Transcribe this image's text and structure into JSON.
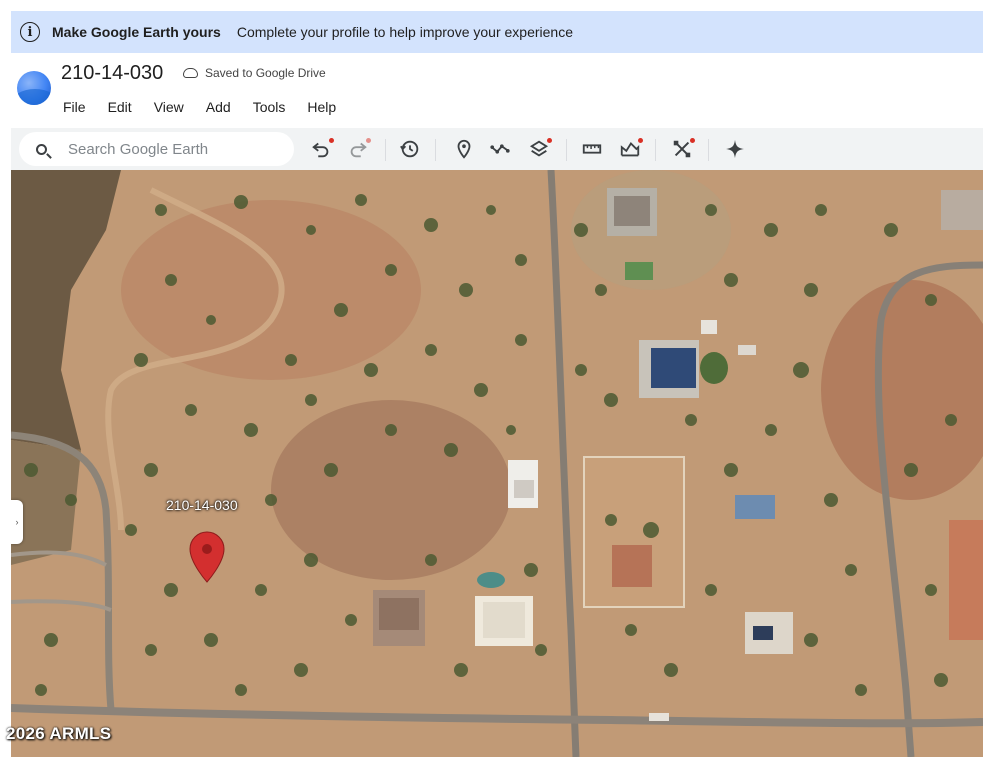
{
  "banner": {
    "title": "Make Google Earth yours",
    "message": "Complete your profile to help improve your experience",
    "icon": "info-icon"
  },
  "header": {
    "project_title": "210-14-030",
    "saved_status": "Saved to Google Drive",
    "menu": [
      "File",
      "Edit",
      "View",
      "Add",
      "Tools",
      "Help"
    ]
  },
  "toolbar": {
    "search_placeholder": "Search Google Earth",
    "tools": [
      "undo-icon",
      "redo-icon",
      "history-icon",
      "add-placemark-icon",
      "add-path-icon",
      "layers-icon",
      "measure-icon",
      "elevation-profile-icon",
      "satellite-tools-icon",
      "gemini-sparkle-icon"
    ]
  },
  "map": {
    "placemark_label": "210-14-030",
    "pin_color": "#d32f2f"
  },
  "watermark": "2026 ARMLS"
}
